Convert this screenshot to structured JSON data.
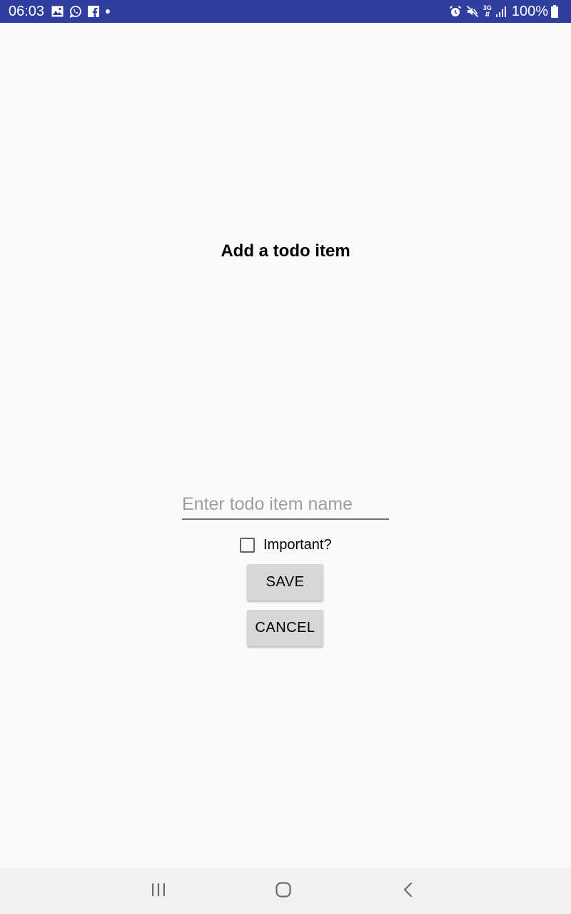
{
  "status_bar": {
    "time": "06:03",
    "network_type": "3G",
    "battery_percent": "100%",
    "background_color": "#303f9f",
    "left_icons": [
      "gallery-icon",
      "whatsapp-icon",
      "facebook-icon",
      "notification-dot-icon"
    ],
    "right_icons": [
      "alarm-icon",
      "mute-icon",
      "network-type-icon",
      "signal-icon",
      "battery-icon"
    ]
  },
  "main": {
    "title": "Add a todo item",
    "input": {
      "placeholder": "Enter todo item name",
      "value": ""
    },
    "important_checkbox": {
      "label": "Important?",
      "checked": false
    },
    "save_button": "SAVE",
    "cancel_button": "CANCEL"
  },
  "nav_bar": {
    "buttons": [
      "recents-icon",
      "home-icon",
      "back-icon"
    ]
  }
}
